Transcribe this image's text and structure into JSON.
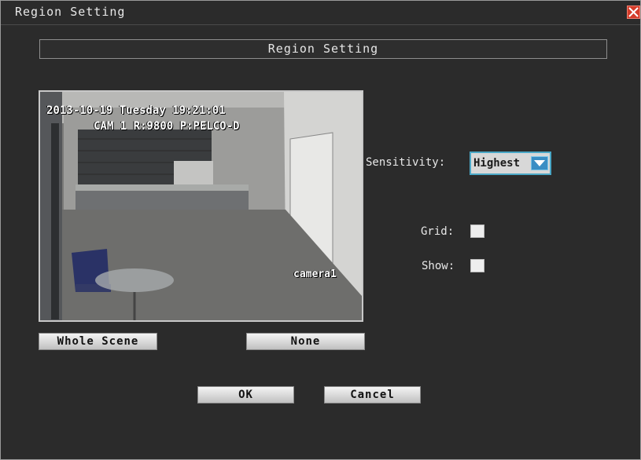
{
  "window": {
    "title": "Region Setting"
  },
  "section": {
    "header": "Region Setting"
  },
  "preview": {
    "osd_date": "2013-10-19 Tuesday 19:21:01",
    "osd_cam": "CAM 1  R:9800 P:PELCO-D",
    "camera_name": "camera1"
  },
  "settings": {
    "sensitivity_label": "Sensitivity:",
    "sensitivity_value": "Highest",
    "grid_label": "Grid:",
    "show_label": "Show:"
  },
  "buttons": {
    "whole_scene": "Whole Scene",
    "none": "None",
    "ok": "OK",
    "cancel": "Cancel"
  },
  "colors": {
    "background": "#2b2b2b",
    "close_button": "#d43c2a",
    "dropdown_accent": "#3a8ec4"
  },
  "icons": {
    "close": "close-x-icon",
    "dropdown": "chevron-down-icon"
  }
}
